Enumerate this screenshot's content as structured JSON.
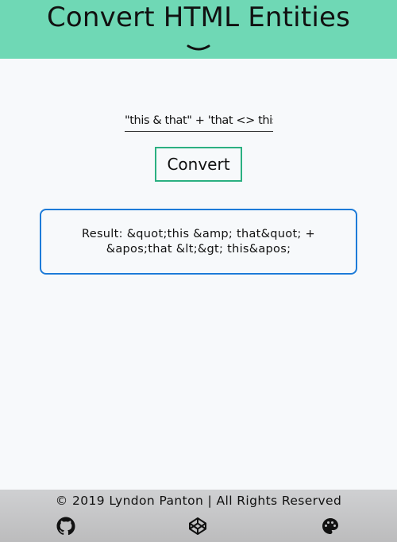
{
  "header": {
    "title": "Convert HTML Entities",
    "toggle_icon": "chevron-down-icon"
  },
  "converter": {
    "input_value": "\"this & that\" + 'that <> this'",
    "button_label": "Convert",
    "result_text": "Result: &quot;this &amp; that&quot; + &apos;that &lt;&gt; this&apos;"
  },
  "footer": {
    "copyright": "© 2019 Lyndon Panton | All Rights Reserved",
    "icons": [
      "github-icon",
      "codepen-icon",
      "palette-icon"
    ]
  },
  "colors": {
    "header_bg": "#6fd8b5",
    "button_border": "#2bb081",
    "result_border": "#1d7bd8",
    "footer_bg": "#c4c5c6"
  }
}
